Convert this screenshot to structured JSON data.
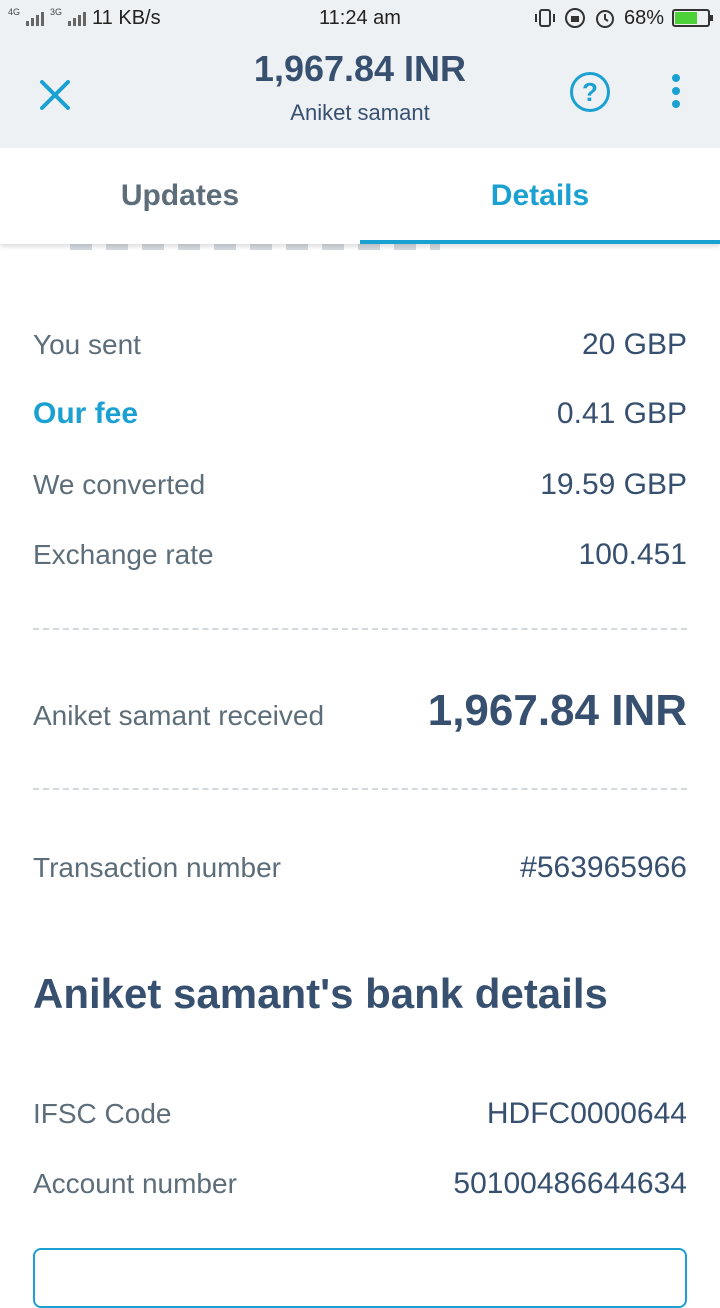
{
  "status_bar": {
    "network_4g": "4G",
    "network_3g": "3G",
    "speed": "11 KB/s",
    "time": "11:24 am",
    "battery_percent": "68%",
    "battery_level": 0.68
  },
  "header": {
    "amount": "1,967.84 INR",
    "recipient": "Aniket samant",
    "help_symbol": "?"
  },
  "tabs": [
    {
      "label": "Updates",
      "active": false
    },
    {
      "label": "Details",
      "active": true
    }
  ],
  "details": {
    "you_sent_label": "You sent",
    "you_sent_value": "20 GBP",
    "fee_label": "Our fee",
    "fee_value": "0.41 GBP",
    "converted_label": "We converted",
    "converted_value": "19.59 GBP",
    "rate_label": "Exchange rate",
    "rate_value": "100.451",
    "received_label": "Aniket samant received",
    "received_value": "1,967.84 INR",
    "transaction_label": "Transaction number",
    "transaction_value": "#563965966"
  },
  "bank": {
    "title": "Aniket samant's bank details",
    "ifsc_label": "IFSC Code",
    "ifsc_value": "HDFC0000644",
    "account_label": "Account number",
    "account_value": "50100486644634"
  },
  "colors": {
    "accent": "#1aa1d1",
    "text_primary": "#37506f",
    "text_secondary": "#5d6e7a",
    "header_bg": "#eef1f4"
  }
}
